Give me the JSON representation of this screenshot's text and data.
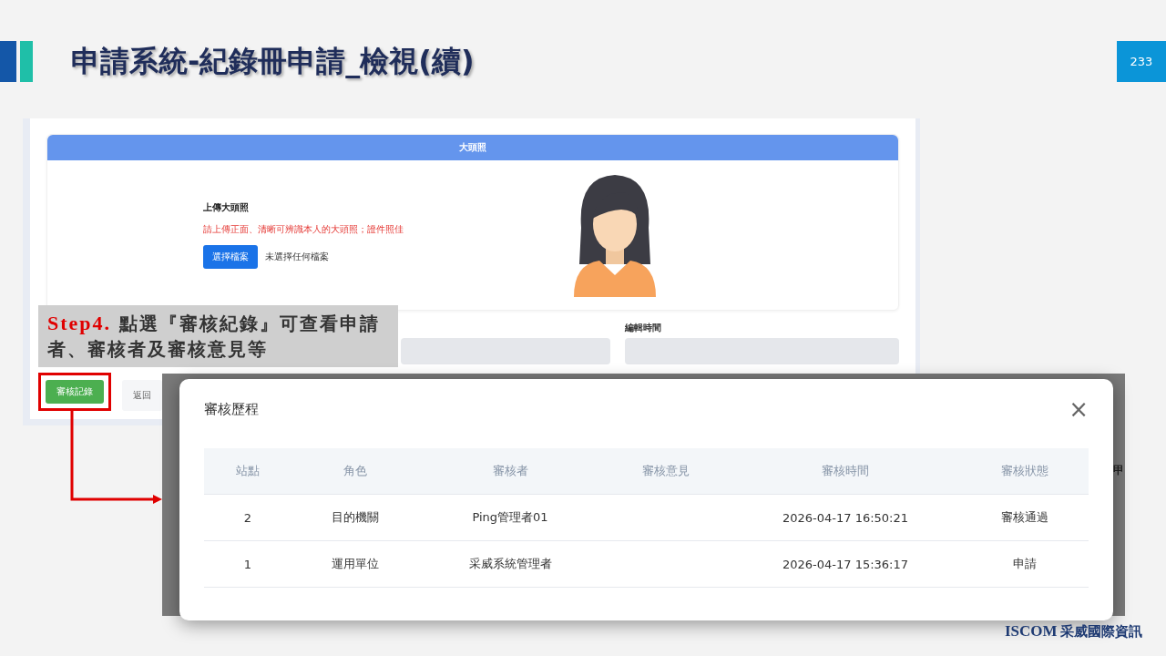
{
  "slide": {
    "title": "申請系統-紀錄冊申請_檢視(續)",
    "page_number": "233"
  },
  "form": {
    "section_header": "大頭照",
    "upload_label": "上傳大頭照",
    "upload_hint": "請上傳正面、清晰可辨識本人的大頭照；證件照佳",
    "file_button": "選擇檔案",
    "file_status": "未選擇任何檔案",
    "field_label": "編輯時間",
    "buttons": [
      {
        "label": "審核記錄",
        "kind": "primary",
        "highlighted": true
      },
      {
        "label": "返回",
        "kind": "plain",
        "highlighted": false
      }
    ]
  },
  "callout": {
    "step": "Step4.",
    "text": "點選『審核紀錄』可查看申請者、審核者及審核意見等"
  },
  "background_page": {
    "side_fragment": "甲"
  },
  "modal": {
    "title": "審核歷程",
    "close": "×",
    "table": {
      "columns": [
        "站點",
        "角色",
        "審核者",
        "審核意見",
        "審核時間",
        "審核狀態"
      ],
      "rows": [
        [
          "2",
          "目的機關",
          "Ping管理者01",
          "",
          "2026-04-17 16:50:21",
          "審核通過"
        ],
        [
          "1",
          "運用單位",
          "采威系統管理者",
          "",
          "2026-04-17 15:36:17",
          "申請"
        ]
      ]
    }
  },
  "logo": {
    "name": "ISCOM",
    "name_zh": "采威國際資訊"
  }
}
